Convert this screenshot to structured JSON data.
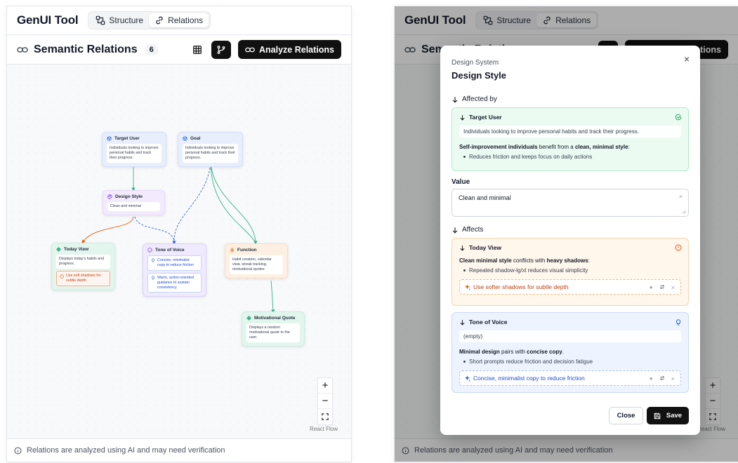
{
  "app": {
    "title": "GenUI Tool"
  },
  "tabs": [
    {
      "label": "Structure"
    },
    {
      "label": "Relations"
    }
  ],
  "toolbar": {
    "title": "Semantic Relations",
    "count": "6",
    "analyze_label": "Analyze Relations"
  },
  "footer": {
    "note": "Relations are analyzed using AI and may need verification"
  },
  "react_flow_label": "React Flow",
  "zoom": {
    "in": "+",
    "out": "−"
  },
  "nodes": {
    "target_user": {
      "title": "Target User",
      "body": "Individuals looking to improve personal habits and track their progress."
    },
    "goal": {
      "title": "Goal",
      "body": "Individuals looking to improve personal habits and track their progress."
    },
    "design_style": {
      "title": "Design Style",
      "body": "Clean and minimal"
    },
    "today_view": {
      "title": "Today View",
      "body": "Displays today's habits and progress.",
      "suggestion": "Use soft shadows for subtle depth"
    },
    "tone_of_voice": {
      "title": "Tone of Voice",
      "items": [
        "Concise, minimalist copy to reduce friction",
        "Warm, action-oriented guidance to sustain consistency"
      ]
    },
    "function": {
      "title": "Function",
      "body": "Habit creation, calendar view, streak tracking, motivational quotes"
    },
    "motivational_quote": {
      "title": "Motivational Quote",
      "body": "Displays a random motivational quote to the user."
    }
  },
  "modal": {
    "category": "Design System",
    "title": "Design Style",
    "close_glyph": "×",
    "affected_by_label": "Affected by",
    "affected_by": {
      "title": "Target User",
      "value": "Individuals looking to improve personal habits and track their progress.",
      "text_b1": "Self-improvement individuals",
      "text_mid": " benefit from a ",
      "text_b2": "clean, minimal style",
      "text_end": ":",
      "bullet": "Reduces friction and keeps focus on daily actions"
    },
    "value_label": "Value",
    "value": "Clean and minimal",
    "value_clear": "×",
    "affects_label": "Affects",
    "affects": [
      {
        "title": "Today View",
        "text_b1": "Clean minimal style",
        "text_mid": " conflicts with ",
        "text_b2": "heavy shadows",
        "text_end": ":",
        "bullet": "Repeated shadow-lg/xl reduces visual simplicity",
        "suggestion": "Use softer shadows for subtle depth"
      },
      {
        "title": "Tone of Voice",
        "value": "(empty)",
        "text_b1": "Minimal design",
        "text_mid": " pairs with ",
        "text_b2": "concise copy",
        "text_end": ".",
        "bullet": "Short prompts reduce friction and decision fatigue",
        "suggestion": "Concise, minimalist copy to reduce friction"
      }
    ],
    "suggestion_add": "+",
    "suggestion_remove": "×",
    "close_label": "Close",
    "save_label": "Save"
  },
  "colors": {
    "accent_dark": "#111111",
    "green": "#16a34a",
    "orange": "#ea580c",
    "blue": "#2563eb",
    "purple": "#7c3aed"
  }
}
